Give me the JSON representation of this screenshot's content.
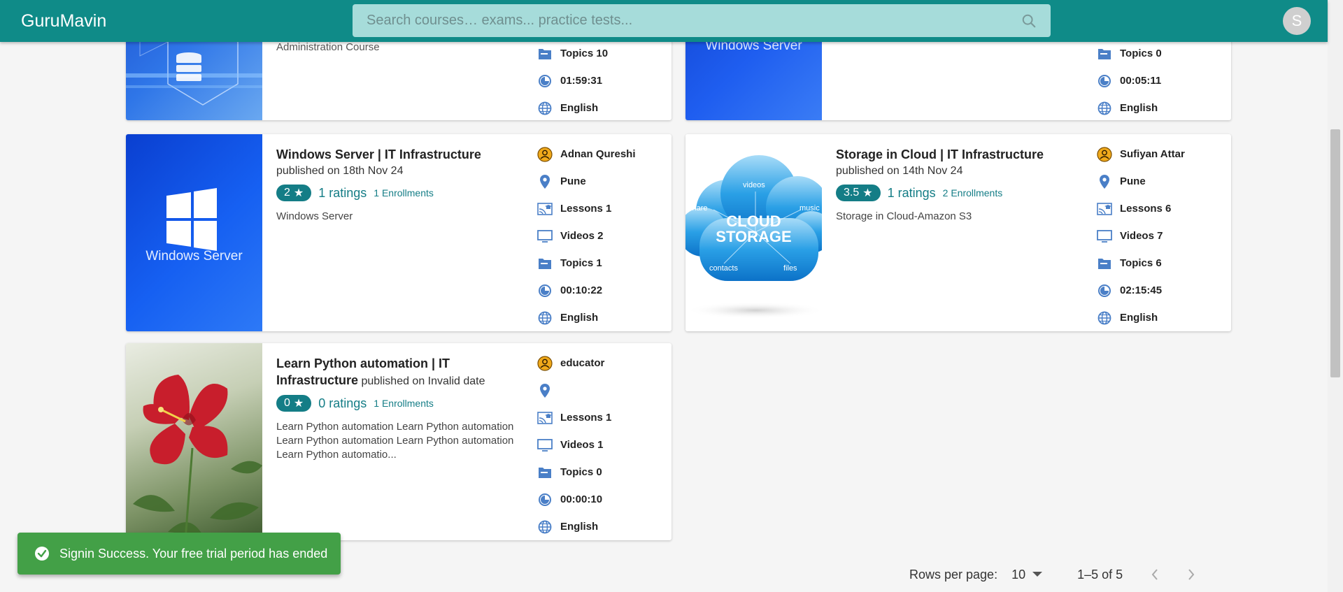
{
  "header": {
    "brand": "GuruMavin",
    "search_placeholder": "Search courses… exams... practice tests...",
    "avatar_initial": "S"
  },
  "colors": {
    "primary": "#0f8b88",
    "accent_teal": "#147d86",
    "success": "#43a047",
    "icon_blue": "#4a7fc7",
    "icon_orange": "#f0a91b"
  },
  "cards": [
    {
      "image_label": "",
      "title": "",
      "subtitle_fragment": "Administration Course",
      "topics": "Topics 10",
      "duration": "01:59:31",
      "language": "English"
    },
    {
      "image_label": "Windows Server",
      "topics": "Topics 0",
      "duration": "00:05:11",
      "language": "English"
    },
    {
      "image_label": "Windows Server",
      "title": "Windows Server | IT Infrastructure",
      "published": "published on 18th Nov 24",
      "rating": "2",
      "ratings_text": "1 ratings",
      "enrollments": "1 Enrollments",
      "description": "Windows Server",
      "author": "Adnan Qureshi",
      "location": "Pune",
      "lessons": "Lessons 1",
      "videos": "Videos 2",
      "topics": "Topics 1",
      "duration": "00:10:22",
      "language": "English"
    },
    {
      "image_words": [
        "videos",
        "share",
        "music",
        "CLOUD",
        "STORAGE",
        "contacts",
        "files"
      ],
      "title": "Storage in Cloud | IT Infrastructure",
      "published": "published on 14th Nov 24",
      "rating": "3.5",
      "ratings_text": "1 ratings",
      "enrollments": "2 Enrollments",
      "description": "Storage in Cloud-Amazon S3",
      "author": "Sufiyan Attar",
      "location": "Pune",
      "lessons": "Lessons 6",
      "videos": "Videos 7",
      "topics": "Topics 6",
      "duration": "02:15:45",
      "language": "English"
    },
    {
      "title": "Learn Python automation | IT Infrastructure",
      "published": "published on Invalid date",
      "rating": "0",
      "ratings_text": "0 ratings",
      "enrollments": "1 Enrollments",
      "description": "Learn Python automation Learn Python automation Learn Python automation Learn Python automation Learn Python automatio...",
      "author": "educator",
      "location": "",
      "lessons": "Lessons 1",
      "videos": "Videos 1",
      "topics": "Topics 0",
      "duration": "00:00:10",
      "language": "English"
    }
  ],
  "snackbar": {
    "message": "Signin Success. Your free trial period has ended"
  },
  "pagination": {
    "rows_per_page_label": "Rows per page:",
    "rows_per_page_value": "10",
    "range": "1–5 of 5"
  }
}
